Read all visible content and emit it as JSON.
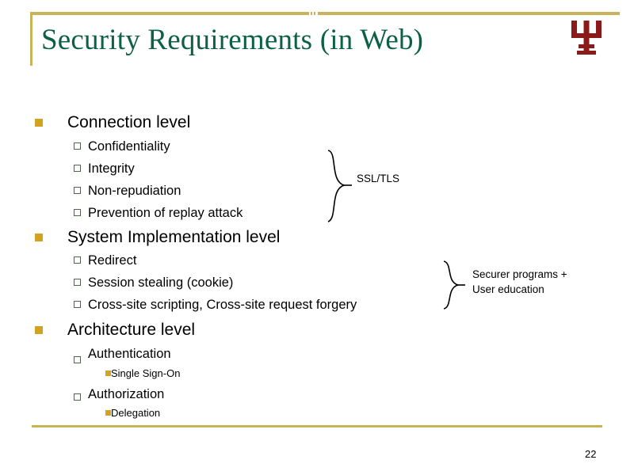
{
  "slide": {
    "title": "Security Requirements (in Web)",
    "page_number": "22",
    "logo_name": "iu-trident-logo",
    "colors": {
      "rule_gold": "#c8b358",
      "title_green": "#0c6046",
      "logo_crimson": "#8b1a1a",
      "bullet_amber": "#d0a322",
      "bullet_green_outline": "#4c6b3c"
    }
  },
  "content": {
    "sections": [
      {
        "heading": "Connection level",
        "items": [
          "Confidentiality",
          "Integrity",
          "Non-repudiation",
          "Prevention of replay attack"
        ]
      },
      {
        "heading": "System Implementation level",
        "items": [
          "Redirect",
          "Session stealing (cookie)",
          "Cross-site scripting, Cross-site request forgery"
        ]
      },
      {
        "heading": "Architecture level",
        "items": [
          "Authentication",
          "Authorization"
        ],
        "subitems": [
          "Single Sign-On",
          "Delegation"
        ]
      }
    ]
  },
  "annotations": {
    "ssl_tls": "SSL/TLS",
    "securer_line1": "Securer programs +",
    "securer_line2": "User education"
  }
}
